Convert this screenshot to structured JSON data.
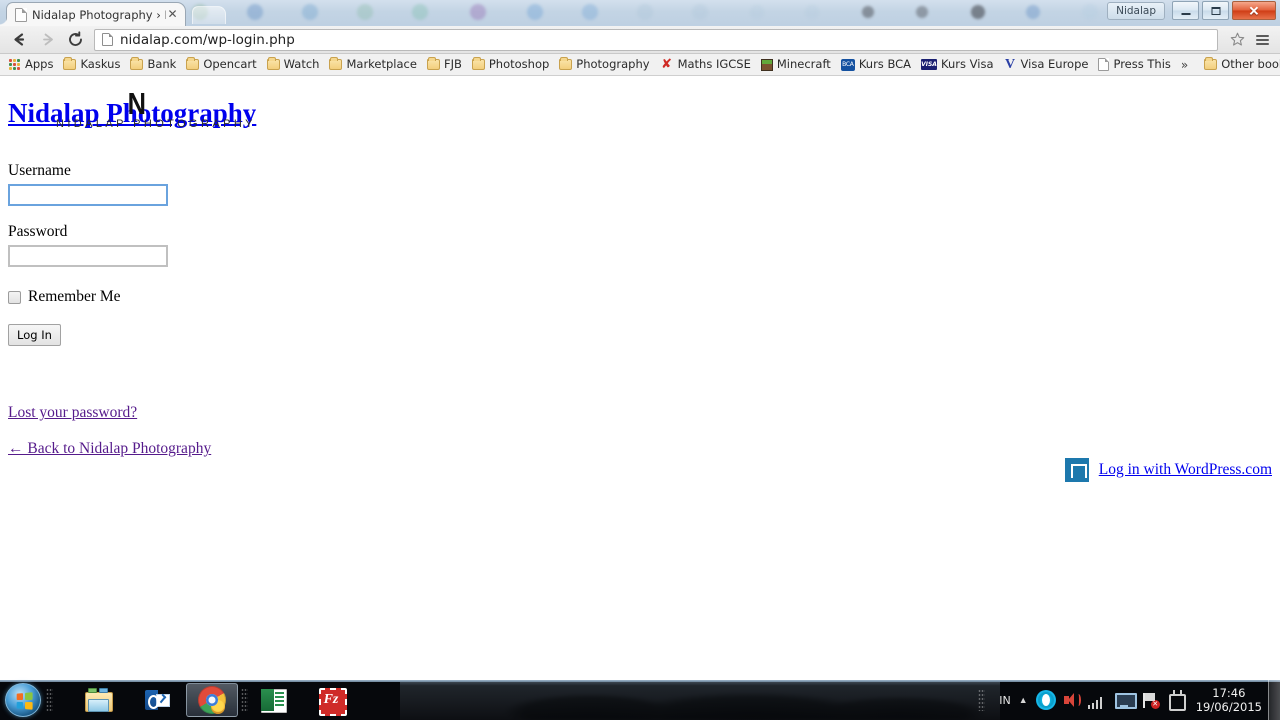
{
  "browser": {
    "tab": {
      "title": "Nidalap Photography › Lo",
      "favicon": "page-icon",
      "close": "✕"
    },
    "caption": {
      "user": "Nidalap",
      "minimize": "minimize",
      "maximize": "maximize",
      "close": "✕"
    },
    "toolbar": {
      "back": "←",
      "forward": "→",
      "reload": "⟳",
      "url": "nidalap.com/wp-login.php",
      "star": "☆",
      "menu": "menu"
    },
    "bookmarks": {
      "apps_label": "Apps",
      "items": [
        {
          "label": "Kaskus",
          "icon": "folder-icon"
        },
        {
          "label": "Bank",
          "icon": "folder-icon"
        },
        {
          "label": "Opencart",
          "icon": "folder-icon"
        },
        {
          "label": "Watch",
          "icon": "folder-icon"
        },
        {
          "label": "Marketplace",
          "icon": "folder-icon"
        },
        {
          "label": "FJB",
          "icon": "folder-icon"
        },
        {
          "label": "Photoshop",
          "icon": "folder-icon"
        },
        {
          "label": "Photography",
          "icon": "folder-icon"
        },
        {
          "label": "Maths IGCSE",
          "icon": "x-icon"
        },
        {
          "label": "Minecraft",
          "icon": "minecraft-icon"
        },
        {
          "label": "Kurs BCA",
          "icon": "bca-icon",
          "icon_text": "BCA"
        },
        {
          "label": "Kurs Visa",
          "icon": "visa-icon",
          "icon_text": "VISA"
        },
        {
          "label": "Visa Europe",
          "icon": "v-icon",
          "icon_text": "V"
        },
        {
          "label": "Press This",
          "icon": "page-icon"
        }
      ],
      "overflow": "»",
      "other_bookmarks": "Other bookmarks"
    }
  },
  "page": {
    "site_title": "Nidalap Photography",
    "logo_mark": "N",
    "logo_subtitle": "NIDALAP PHOTOGRAPHY",
    "username_label": "Username",
    "username_value": "",
    "password_label": "Password",
    "password_value": "",
    "remember_label": "Remember Me",
    "login_button": "Log In",
    "lost_password": "Lost your password?",
    "back_to_site": "← Back to Nidalap Photography",
    "wordpress_login": "Log in with WordPress.com",
    "colors": {
      "link_unvisited": "#0000ee",
      "link_visited": "#551a8b",
      "focus_border": "#6aa3de",
      "wordpress_blue": "#1d78ad"
    }
  },
  "taskbar": {
    "start": "start-orb",
    "items": [
      {
        "name": "windows-explorer",
        "active": false
      },
      {
        "name": "microsoft-outlook",
        "active": false
      },
      {
        "name": "google-chrome",
        "active": true
      },
      {
        "name": "microsoft-excel",
        "active": false
      },
      {
        "name": "filezilla",
        "active": false
      }
    ],
    "tray": {
      "language": "IN",
      "show_hidden": "▲",
      "icons": [
        "opera-icon",
        "volume-icon",
        "signal-icon",
        "display-icon",
        "network-icon",
        "power-icon"
      ],
      "time": "17:46",
      "date": "19/06/2015"
    }
  }
}
